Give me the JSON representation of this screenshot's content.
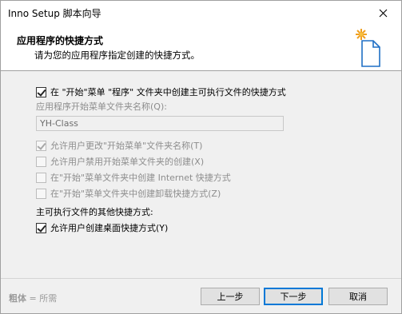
{
  "window": {
    "title": "Inno Setup 脚本向导"
  },
  "header": {
    "title": "应用程序的快捷方式",
    "subtitle": "请为您的应用程序指定创建的快捷方式。"
  },
  "options": {
    "start_menu_shortcut": {
      "label": "在 \"开始\"菜单 \"程序\" 文件夹中创建主可执行文件的快捷方式",
      "checked": true
    },
    "folder_name_label": "应用程序开始菜单文件夹名称(Q):",
    "folder_name_value": "YH-Class",
    "allow_change_folder": {
      "label": "允许用户更改\"开始菜单\"文件夹名称(T)",
      "checked": true,
      "enabled": false
    },
    "allow_disable_folder": {
      "label": "允许用户禁用开始菜单文件夹的创建(X)",
      "checked": false,
      "enabled": false
    },
    "internet_shortcut": {
      "label": "在\"开始\"菜单文件夹中创建 Internet 快捷方式",
      "checked": false,
      "enabled": false
    },
    "uninstall_shortcut": {
      "label": "在\"开始\"菜单文件夹中创建卸载快捷方式(Z)",
      "checked": false,
      "enabled": false
    },
    "other_shortcuts_label": "主可执行文件的其他快捷方式:",
    "desktop_shortcut": {
      "label": "允许用户创建桌面快捷方式(Y)",
      "checked": true
    }
  },
  "footer": {
    "note_bold": "粗体",
    "note_rest": " = 所需",
    "back_label": "上一步",
    "next_label": "下一步",
    "cancel_label": "取消"
  }
}
